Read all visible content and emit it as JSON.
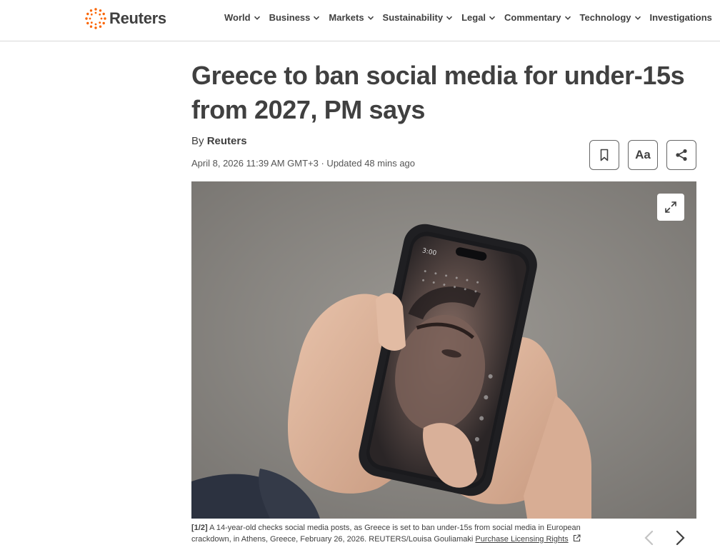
{
  "header": {
    "logo_text": "Reuters",
    "nav": [
      {
        "label": "World"
      },
      {
        "label": "Business"
      },
      {
        "label": "Markets"
      },
      {
        "label": "Sustainability"
      },
      {
        "label": "Legal"
      },
      {
        "label": "Commentary"
      },
      {
        "label": "Technology"
      },
      {
        "label": "Investigations"
      }
    ]
  },
  "article": {
    "headline": "Greece to ban social media for under-15s from 2027, PM says",
    "byline_prefix": "By",
    "author": "Reuters",
    "dateline": "April 8, 2026 11:39 AM GMT+3 · Updated 48 mins ago",
    "tools": {
      "text_size_label": "Aa",
      "icons": [
        "bookmark-icon",
        "text-size",
        "share-icon"
      ]
    }
  },
  "gallery": {
    "counter": "[1/2]",
    "caption": "A 14-year-old checks social media posts, as Greece is set to ban under-15s from social media in European crackdown, in Athens, Greece, February 26, 2026. REUTERS/Louisa Gouliamaki",
    "license_link": "Purchase Licensing Rights",
    "phone_time": "3:00",
    "icons": [
      "expand-icon",
      "previous-arrow-icon",
      "next-arrow-icon",
      "external-link-icon"
    ]
  },
  "colors": {
    "brand_orange": "#fa6400",
    "text": "#404040",
    "border": "#d9d9d9"
  }
}
